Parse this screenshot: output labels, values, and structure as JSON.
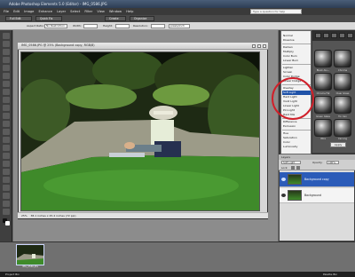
{
  "app": {
    "title": "Adobe Photoshop Elements 5.0 (Editor) - IMG_0586.JPG",
    "menus": [
      "File",
      "Edit",
      "Image",
      "Enhance",
      "Layer",
      "Select",
      "Filter",
      "View",
      "Window",
      "Help"
    ],
    "search_help_placeholder": "Type a question for help"
  },
  "shortcuts": {
    "full_edit": "Full Edit",
    "quick_fix": "Quick Fix",
    "create": "Create",
    "organize": "Organize"
  },
  "options": {
    "aspect_label": "Aspect Ratio:",
    "aspect_value": "No Restriction",
    "width_label": "Width:",
    "height_label": "Height:",
    "resolution_label": "Resolution:",
    "resolution_unit": "pixels/inch"
  },
  "document": {
    "tab_title": "IMG_0586.JPG @ 25% (Background copy, RGB/8)",
    "zoom": "25%",
    "status": "38.1 inches x 25.4 inches (72 ppi)"
  },
  "blend_modes": {
    "groups": [
      [
        "Normal",
        "Dissolve"
      ],
      [
        "Darken",
        "Multiply",
        "Color Burn",
        "Linear Burn"
      ],
      [
        "Lighten",
        "Screen",
        "Color Dodge",
        "Linear Dodge"
      ],
      [
        "Overlay",
        "Soft Light",
        "Hard Light",
        "Vivid Light",
        "Linear Light",
        "Pin Light",
        "Hard Mix"
      ],
      [
        "Difference",
        "Exclusion"
      ],
      [
        "Hue",
        "Saturation",
        "Color",
        "Luminosity"
      ]
    ],
    "selected": "Soft Light"
  },
  "styles_panel": {
    "swatches": [
      "Black Alu...",
      "Chrome",
      "Chrome Fat",
      "Clear Glass",
      "Green Glass",
      "Tin Can",
      "Wire",
      "Carving"
    ],
    "apply_label": "Apply"
  },
  "layers": {
    "tab_label": "Layers",
    "mode_value": "Soft Light",
    "opacity_label": "Opacity:",
    "opacity_value": "100%",
    "lock_label": "Lock:",
    "items": [
      {
        "name": "Background copy",
        "selected": true
      },
      {
        "name": "Background",
        "selected": false
      }
    ]
  },
  "project_bin": {
    "thumb_label": "IMG_0586.JPG"
  },
  "bottom_bar": {
    "left": "Project Bin",
    "right": "Palette Bin"
  },
  "colors": {
    "accent": "#1f52a8",
    "annotation_circle": "#d0202a"
  }
}
